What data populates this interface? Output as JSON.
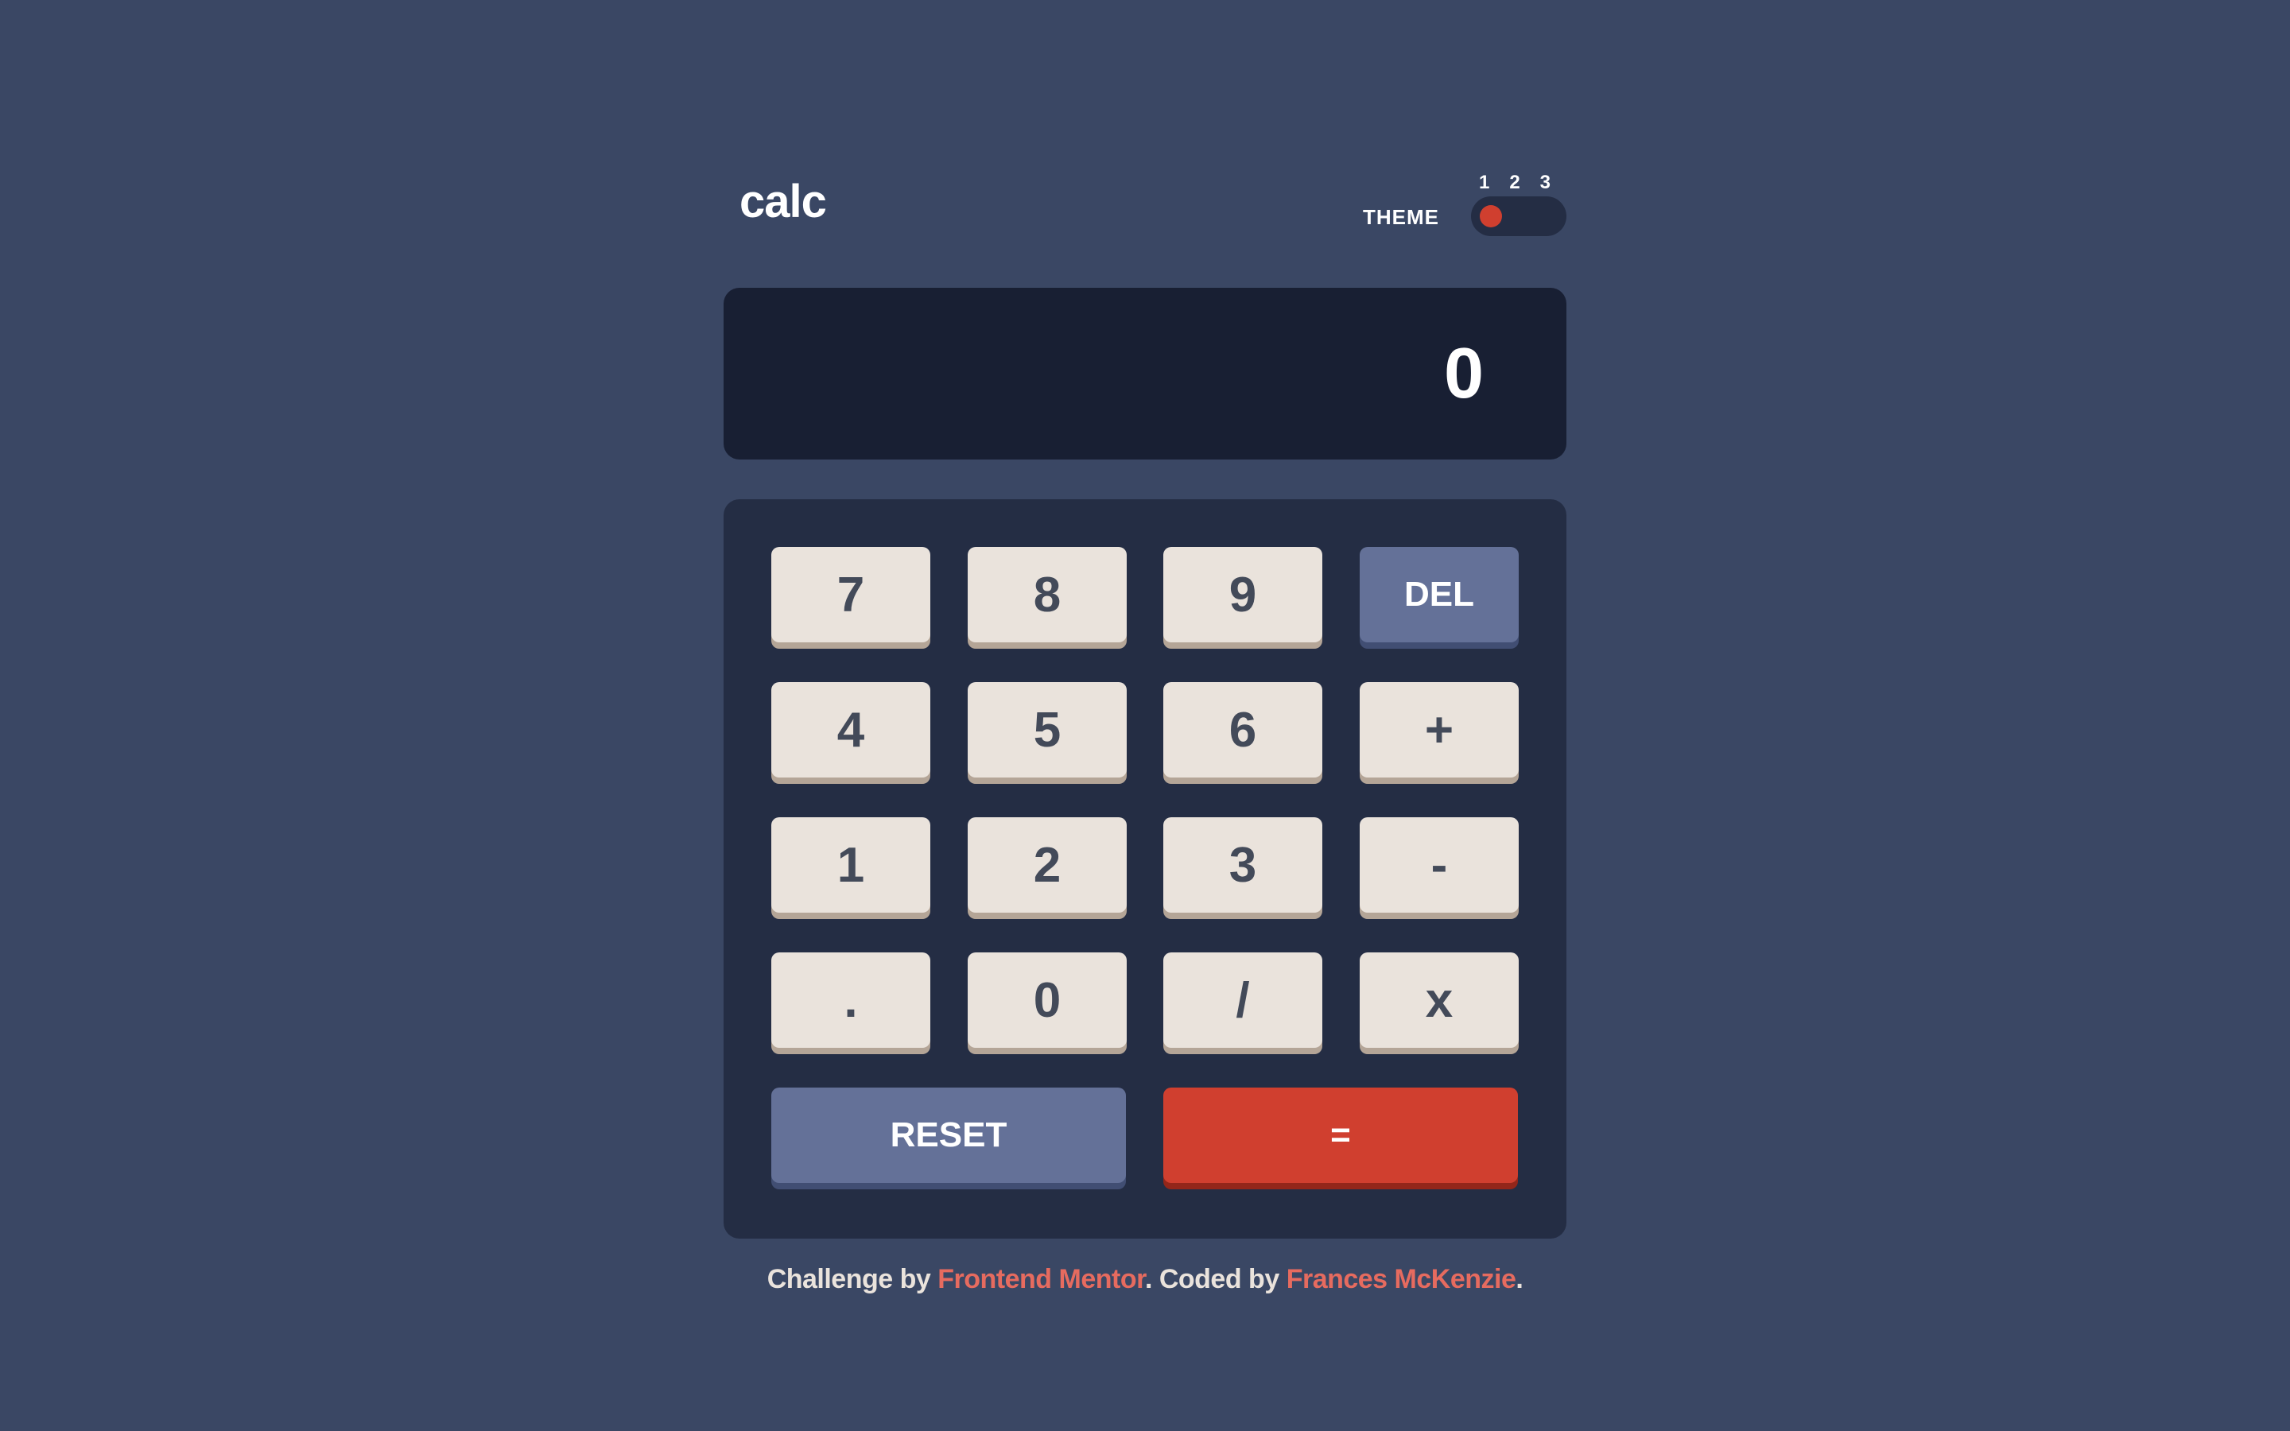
{
  "header": {
    "logo": "calc",
    "theme_label": "THEME",
    "theme_options": [
      "1",
      "2",
      "3"
    ],
    "theme_selected": "1"
  },
  "display": {
    "value": "0"
  },
  "keys": {
    "k7": "7",
    "k8": "8",
    "k9": "9",
    "del": "DEL",
    "k4": "4",
    "k5": "5",
    "k6": "6",
    "plus": "+",
    "k1": "1",
    "k2": "2",
    "k3": "3",
    "minus": "-",
    "dot": ".",
    "k0": "0",
    "divide": "/",
    "multiply": "x",
    "reset": "RESET",
    "equals": "="
  },
  "footer": {
    "prefix": "Challenge by ",
    "link1": "Frontend Mentor",
    "middle": ". Coded by ",
    "link2": "Frances McKenzie",
    "suffix": "."
  },
  "colors": {
    "background": "#3a4764",
    "screen": "#181f33",
    "keypad": "#242d44",
    "key": "#eae3dc",
    "key_blue": "#647198",
    "key_red": "#d03f2f",
    "link": "#e66b5f"
  }
}
